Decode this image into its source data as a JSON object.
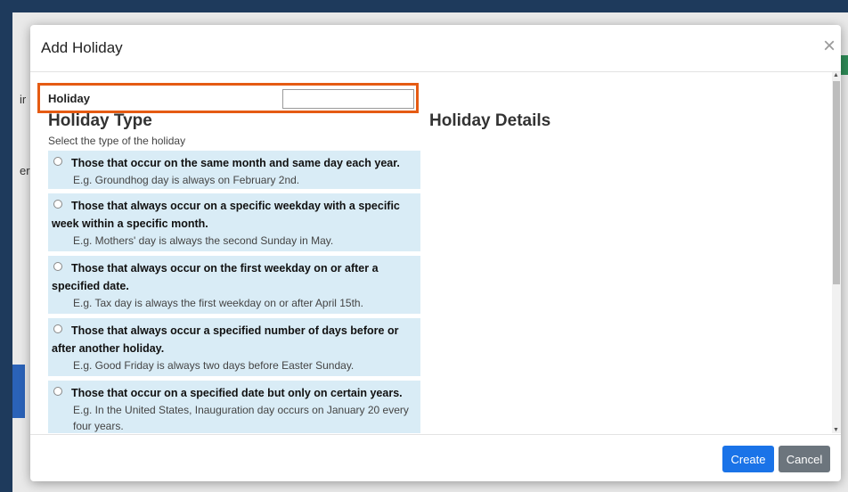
{
  "background": {
    "fragments": [
      "ir",
      "er"
    ]
  },
  "modal": {
    "title": "Add Holiday",
    "close_glyph": "×",
    "holiday_label": "Holiday",
    "holiday_value": "",
    "type_heading": "Holiday Type",
    "type_subtitle": "Select the type of the holiday",
    "details_heading": "Holiday Details",
    "options": [
      {
        "title": "Those that occur on the same month and same day each year.",
        "example": "E.g. Groundhog day is always on February 2nd."
      },
      {
        "title": "Those that always occur on a specific weekday with a specific week within a specific month.",
        "example": "E.g. Mothers' day is always the second Sunday in May."
      },
      {
        "title": "Those that always occur on the first weekday on or after a specified date.",
        "example": "E.g. Tax day is always the first weekday on or after April 15th."
      },
      {
        "title": "Those that always occur a specified number of days before or after another holiday.",
        "example": "E.g. Good Friday is always two days before Easter Sunday."
      },
      {
        "title": "Those that occur on a specified date but only on certain years.",
        "example": "E.g. In the United States, Inauguration day occurs on January 20 every four years."
      }
    ],
    "buttons": {
      "create": "Create",
      "cancel": "Cancel"
    }
  },
  "colors": {
    "highlight": "#e55b13",
    "option_bg": "#d9ecf6",
    "primary": "#1a73e8",
    "secondary": "#6c757d"
  }
}
